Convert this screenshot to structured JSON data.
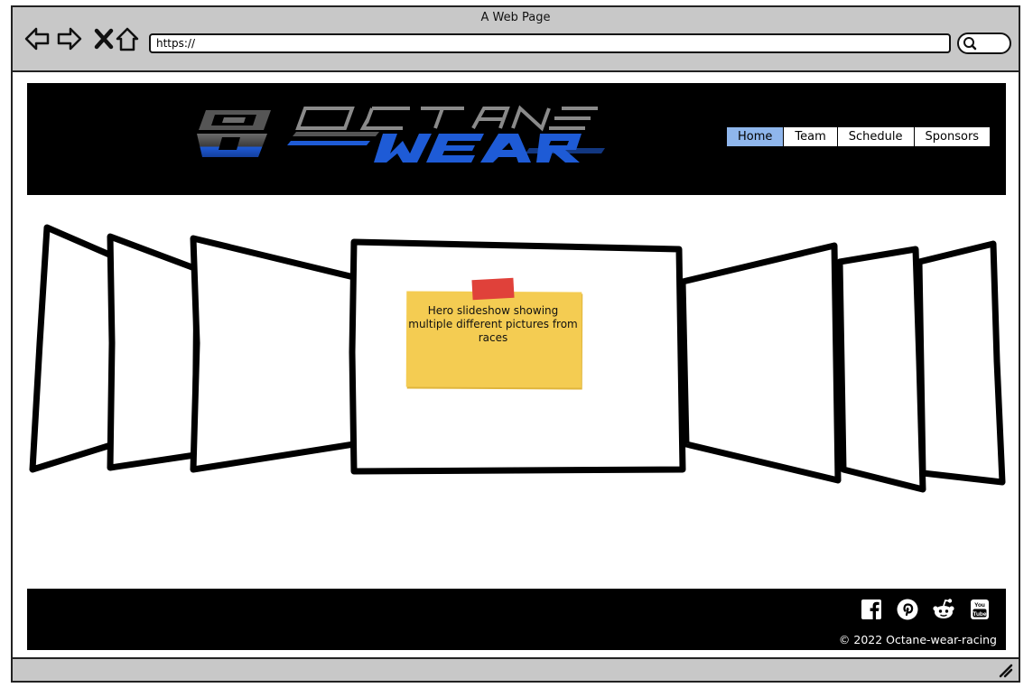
{
  "browser": {
    "window_title": "A Web Page",
    "url": "https://"
  },
  "header": {
    "logo_text": "OCTANE WEAR",
    "logo_mark": "OW",
    "nav": [
      {
        "label": "Home",
        "active": true
      },
      {
        "label": "Team",
        "active": false
      },
      {
        "label": "Schedule",
        "active": false
      },
      {
        "label": "Sponsors",
        "active": false
      }
    ]
  },
  "hero": {
    "note": "Hero slideshow showing multiple different pictures from races"
  },
  "footer": {
    "social_icons": [
      "facebook-icon",
      "pinterest-icon",
      "reddit-icon",
      "youtube-icon"
    ],
    "copyright": "© 2022 Octane-wear-racing"
  },
  "colors": {
    "chrome": "#c8c8c8",
    "header_bg": "#000000",
    "nav_active": "#8fb6ec",
    "sticky_note": "#f4cc52",
    "sticky_tape": "#e0413a",
    "logo_blue": "#1e5bd6"
  }
}
